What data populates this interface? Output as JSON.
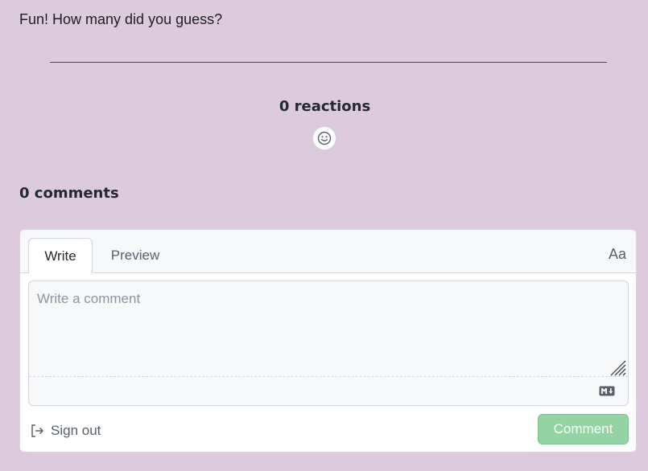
{
  "post": {
    "text": "Fun! How many did you guess?"
  },
  "reactions": {
    "title": "0 reactions",
    "icon": "smiley-icon"
  },
  "comments": {
    "title": "0 comments",
    "tabs": {
      "write": "Write",
      "preview": "Preview"
    },
    "text_size_toggle": "Aa",
    "input": {
      "value": "",
      "placeholder": "Write a comment"
    },
    "markdown_icon": "markdown-icon",
    "sign_out": "Sign out",
    "submit": "Comment"
  },
  "colors": {
    "background": "#ddcbdd",
    "comment_button": "#94d3a2",
    "accent_text": "#24292f"
  }
}
